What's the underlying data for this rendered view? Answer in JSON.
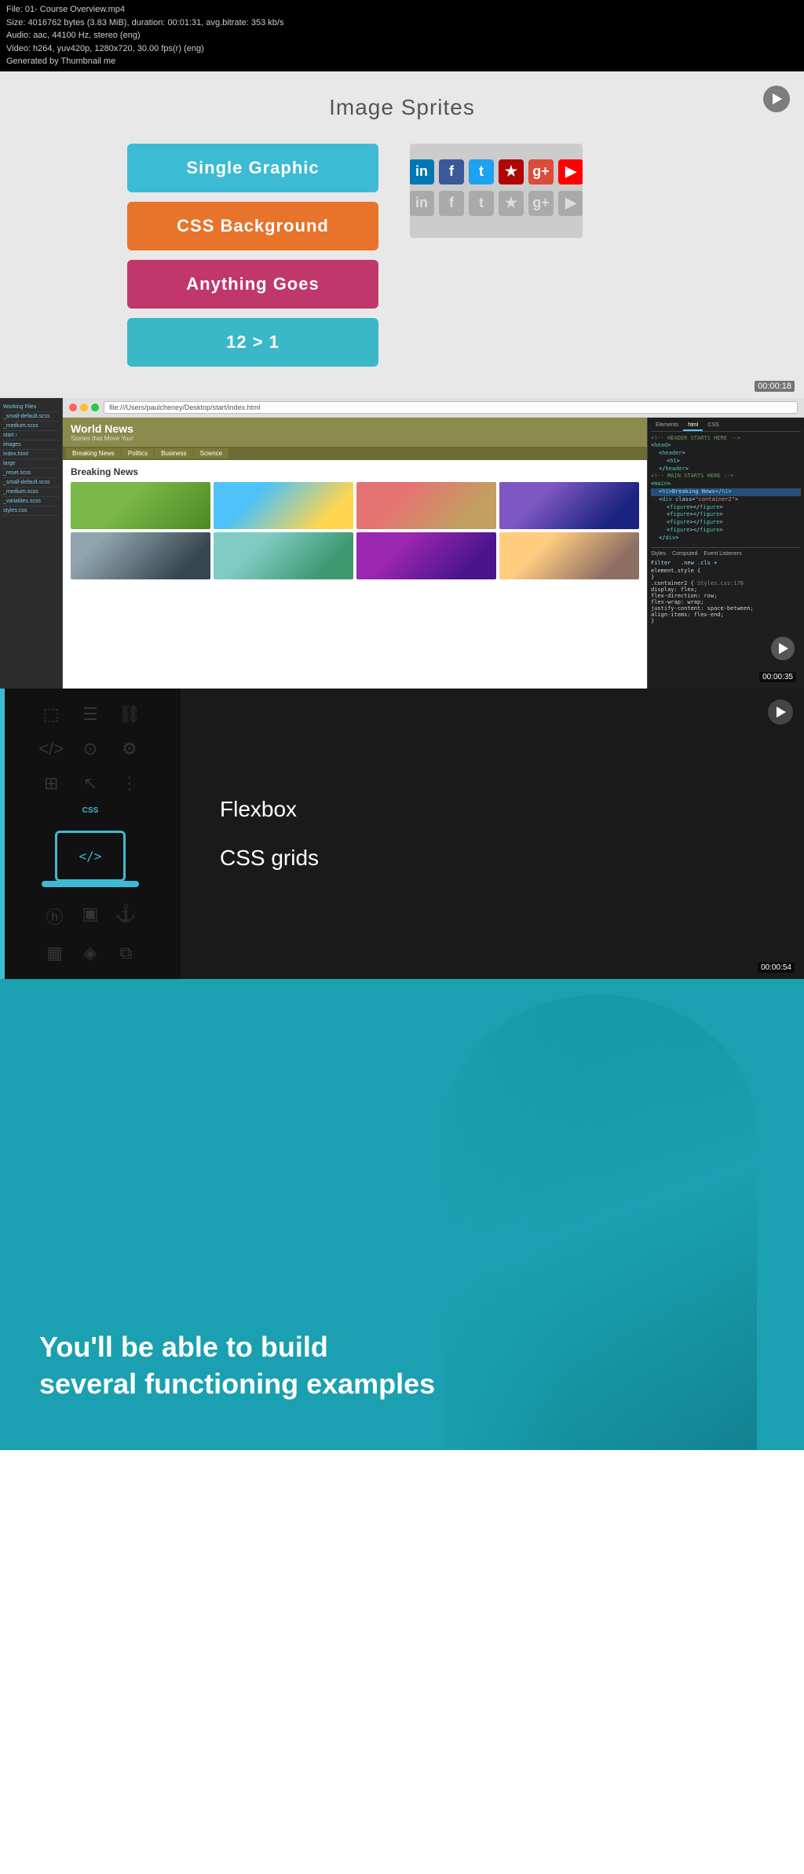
{
  "meta": {
    "line1": "File: 01- Course Overview.mp4",
    "line2": "Size: 4016762 bytes (3.83 MiB), duration: 00:01:31, avg.bitrate: 353 kb/s",
    "line3": "Audio: aac, 44100 Hz, stereo (eng)",
    "line4": "Video: h264, yuv420p, 1280x720, 30.00 fps(r) (eng)",
    "line5": "Generated by Thumbnail me"
  },
  "sprites_section": {
    "title": "Image Sprites",
    "buttons": [
      {
        "label": "Single Graphic",
        "color_class": "btn-blue"
      },
      {
        "label": "CSS Background",
        "color_class": "btn-orange"
      },
      {
        "label": "Anything Goes",
        "color_class": "btn-pink"
      },
      {
        "label": "12 > 1",
        "color_class": "btn-teal"
      }
    ],
    "timestamp": "00:00:18"
  },
  "browser_section": {
    "url": "file:///Users/paulcheney/Desktop/start/index.html",
    "tab_label": "World News",
    "news_title": "World News",
    "news_subtitle": "Stories that Move You!",
    "nav_items": [
      "Breaking News",
      "Politics",
      "Business",
      "Science"
    ],
    "breaking_heading": "Breaking News",
    "timestamp": "00:00:35"
  },
  "topics_section": {
    "topics": [
      "Flexbox",
      "CSS grids"
    ],
    "timestamp": "00:00:54"
  },
  "build_section": {
    "heading_line1": "You'll be able to build",
    "heading_line2": "several functioning examples"
  },
  "icons": {
    "laptop_code": "</>"
  },
  "social_icons": [
    {
      "label": "in",
      "class": "si-linkedin"
    },
    {
      "label": "f",
      "class": "si-facebook"
    },
    {
      "label": "t",
      "class": "si-twitter"
    },
    {
      "label": "★",
      "class": "si-yelp"
    },
    {
      "label": "g+",
      "class": "si-gplus"
    },
    {
      "label": "▶",
      "class": "si-youtube"
    }
  ]
}
